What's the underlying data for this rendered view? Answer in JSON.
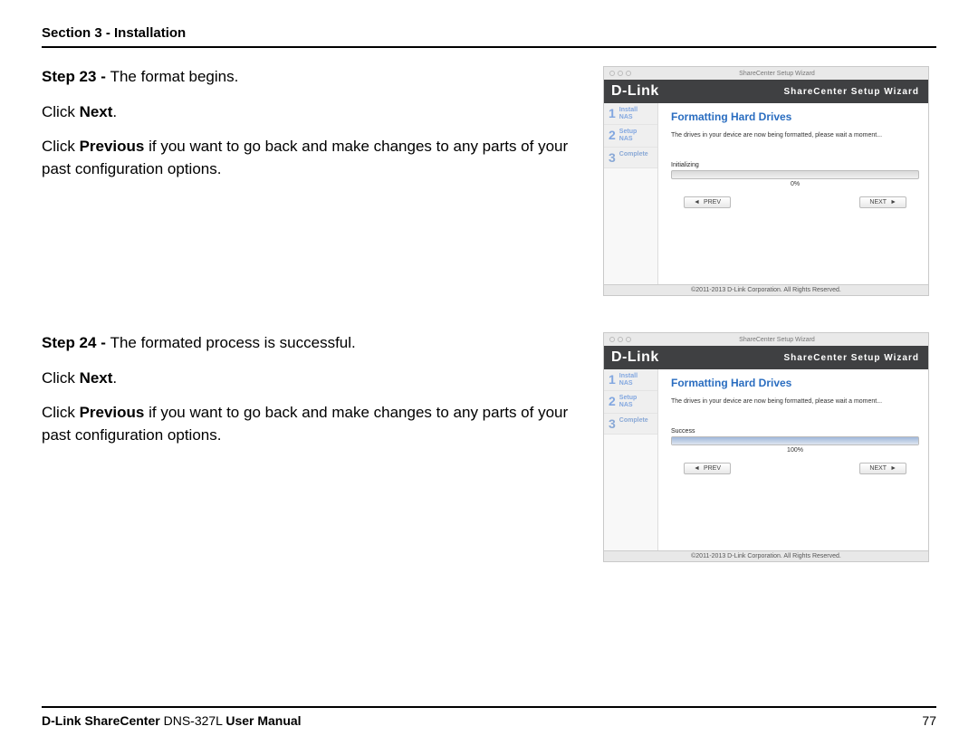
{
  "header": {
    "section_label": "Section 3 - Installation"
  },
  "steps": [
    {
      "step_prefix": "Step 23 - ",
      "step_text": "The format begins.",
      "click_prefix": "Click ",
      "click_bold": "Next",
      "click_suffix": ".",
      "prev_prefix": "Click ",
      "prev_bold": "Previous",
      "prev_suffix": " if you want to go back and make changes to any parts of your past configuration options.",
      "wizard": {
        "titlebar": "ShareCenter Setup Wizard",
        "brand": "D-Link",
        "header_title": "ShareCenter Setup Wizard",
        "side": [
          {
            "n": "1",
            "a": "Install",
            "b": "NAS"
          },
          {
            "n": "2",
            "a": "Setup",
            "b": "NAS"
          },
          {
            "n": "3",
            "a": "Complete",
            "b": ""
          }
        ],
        "panel_title": "Formatting Hard Drives",
        "panel_msg": "The drives in your device are now being formatted, please wait a moment...",
        "status_label": "Initializing",
        "progress_pct": "0%",
        "progress_fill": "0%",
        "btn_prev": "PREV",
        "btn_next": "NEXT",
        "footer": "©2011-2013 D-Link Corporation. All Rights Reserved."
      }
    },
    {
      "step_prefix": "Step 24 - ",
      "step_text": "The formated process is successful.",
      "click_prefix": "Click ",
      "click_bold": "Next",
      "click_suffix": ".",
      "prev_prefix": "Click ",
      "prev_bold": "Previous",
      "prev_suffix": " if you want to go back and make changes to any parts of your past configuration options.",
      "wizard": {
        "titlebar": "ShareCenter Setup Wizard",
        "brand": "D-Link",
        "header_title": "ShareCenter Setup Wizard",
        "side": [
          {
            "n": "1",
            "a": "Install",
            "b": "NAS"
          },
          {
            "n": "2",
            "a": "Setup",
            "b": "NAS"
          },
          {
            "n": "3",
            "a": "Complete",
            "b": ""
          }
        ],
        "panel_title": "Formatting Hard Drives",
        "panel_msg": "The drives in your device are now being formatted, please wait a moment...",
        "status_label": "Success",
        "progress_pct": "100%",
        "progress_fill": "100%",
        "btn_prev": "PREV",
        "btn_next": "NEXT",
        "footer": "©2011-2013 D-Link Corporation. All Rights Reserved."
      }
    }
  ],
  "footer": {
    "product_bold1": "D-Link ShareCenter",
    "product_plain": " DNS-327L ",
    "product_bold2": "User Manual",
    "page_number": "77"
  }
}
